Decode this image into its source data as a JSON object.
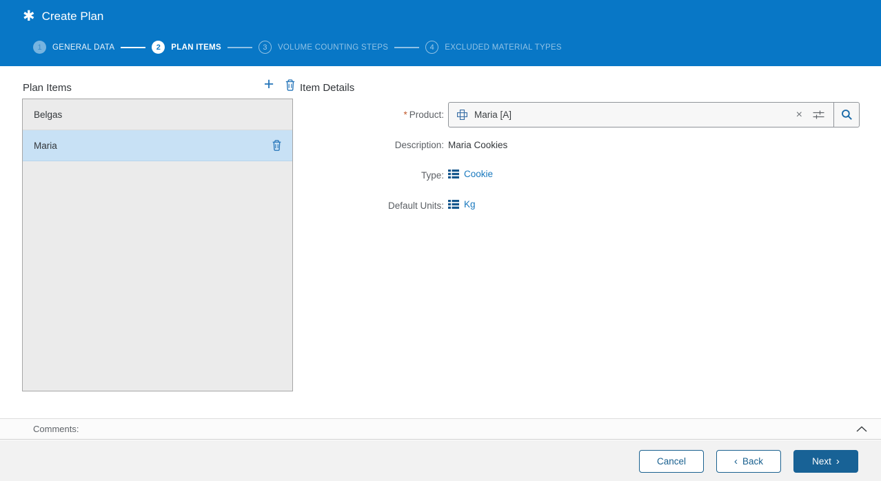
{
  "header": {
    "title": "Create Plan",
    "icon": "asterisk-icon",
    "accent_color": "#0877c6"
  },
  "steps": [
    {
      "num": "1",
      "label": "GENERAL DATA",
      "state": "done"
    },
    {
      "num": "2",
      "label": "PLAN ITEMS",
      "state": "active"
    },
    {
      "num": "3",
      "label": "VOLUME COUNTING STEPS",
      "state": "future"
    },
    {
      "num": "4",
      "label": "EXCLUDED MATERIAL TYPES",
      "state": "future"
    }
  ],
  "plan_items": {
    "title": "Plan Items",
    "add_icon": "plus-icon",
    "delete_icon": "trash-icon",
    "items": [
      {
        "name": "Belgas",
        "selected": false
      },
      {
        "name": "Maria",
        "selected": true
      }
    ],
    "selected_row_color": "#c8e1f5"
  },
  "item_details": {
    "title": "Item Details",
    "product": {
      "label": "Product:",
      "required_marker": "*",
      "value": "Maria [A]",
      "clear_icon": "x",
      "field_icons": [
        "product-icon",
        "clear-icon",
        "tune-icon",
        "search-icon"
      ]
    },
    "description": {
      "label": "Description:",
      "value": "Maria Cookies"
    },
    "type": {
      "label": "Type:",
      "value": "Cookie",
      "icon": "list-icon"
    },
    "default_units": {
      "label": "Default Units:",
      "value": "Kg",
      "icon": "list-icon"
    },
    "link_color": "#1878be"
  },
  "comments": {
    "label": "Comments:",
    "collapse_icon": "chevron-up-icon"
  },
  "footer": {
    "cancel_label": "Cancel",
    "back_label": "Back",
    "back_chevron": "‹",
    "next_label": "Next",
    "next_chevron": "›",
    "primary_color": "#186296"
  }
}
